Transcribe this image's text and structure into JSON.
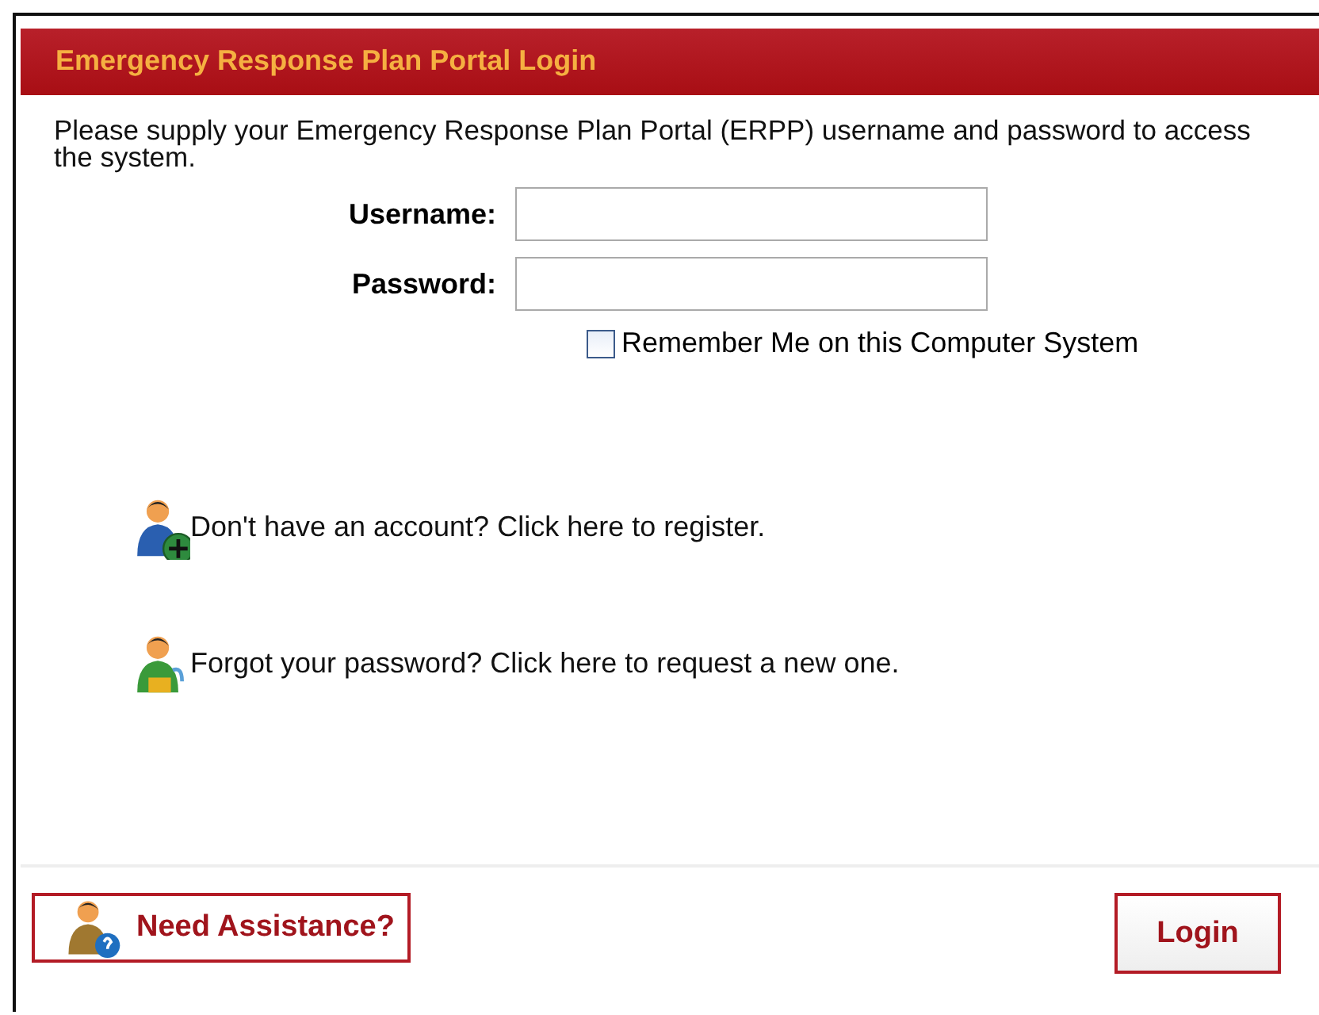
{
  "panel": {
    "title": "Emergency Response Plan Portal Login"
  },
  "intro": "Please supply your Emergency Response Plan Portal (ERPP) username and password to access the system.",
  "fields": [
    {
      "label": "Username:"
    },
    {
      "label": "Password:"
    }
  ],
  "remember": {
    "label": "Remember Me on this Computer System",
    "checked": false
  },
  "links": [
    {
      "text": "Don't have an account? Click here to register.",
      "kind": "register"
    },
    {
      "text": "Forgot your password? Click here to request a new one.",
      "kind": "forgot"
    }
  ],
  "buttons": {
    "help": "Need Assistance?",
    "login": "Login"
  }
}
